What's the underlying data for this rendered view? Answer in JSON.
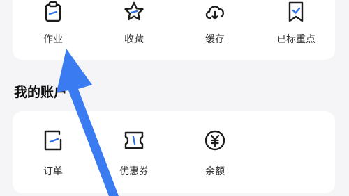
{
  "top_grid": {
    "items": [
      {
        "label": "作业",
        "icon": "clipboard-icon"
      },
      {
        "label": "收藏",
        "icon": "star-icon"
      },
      {
        "label": "缓存",
        "icon": "cloud-download-icon"
      },
      {
        "label": "已标重点",
        "icon": "bookmark-check-icon"
      }
    ]
  },
  "account": {
    "title": "我的账户",
    "items": [
      {
        "label": "订单",
        "icon": "order-icon"
      },
      {
        "label": "优惠券",
        "icon": "coupon-icon"
      },
      {
        "label": "余额",
        "icon": "yuan-coin-icon"
      }
    ]
  },
  "colors": {
    "accent": "#2f6fe4",
    "arrow": "#3a7bf2",
    "icon_stroke": "#1c1c1c"
  }
}
